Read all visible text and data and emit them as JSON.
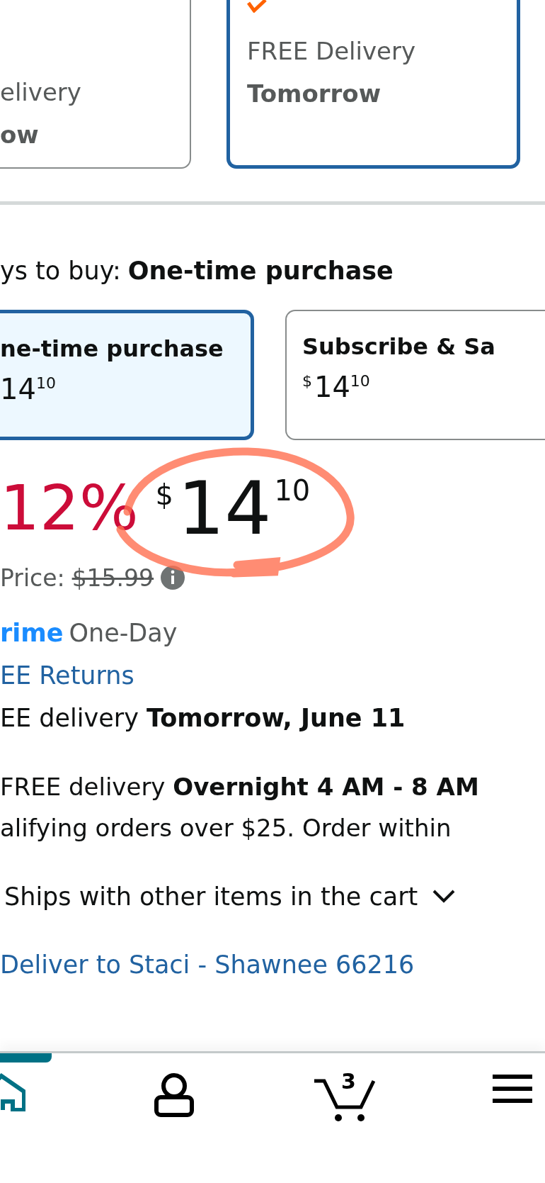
{
  "delivery_options": [
    {
      "lines": [
        "elivery",
        "ow"
      ],
      "selected": false,
      "prime": false
    },
    {
      "lines": [
        "FREE Delivery",
        "Tomorrow"
      ],
      "selected": true,
      "prime": true
    }
  ],
  "ways_to_buy": {
    "label": "ys to buy:",
    "value": "One-time purchase"
  },
  "purchase_options": [
    {
      "title": "ne-time purchase",
      "whole": "14",
      "fraction": "10",
      "selected": true
    },
    {
      "title": "Subscribe & Sa",
      "currency": "$",
      "whole": "14",
      "fraction": "10",
      "selected": false
    }
  ],
  "price": {
    "discount": "12%",
    "currency": "$",
    "whole": "14",
    "fraction": "10",
    "list_price_label": "Price:",
    "list_price": "$15.99"
  },
  "prime_badge": {
    "logo_text": "rime",
    "label": "One-Day"
  },
  "returns_link": "EE Returns",
  "delivery_line": "EE delivery **Tomorrow, June 11**",
  "fast_delivery": [
    "FREE delivery **Overnight 4 AM - 8 AM**",
    "alifying orders over $25. Order within"
  ],
  "ships_with": {
    "label": "Ships with other items in the cart",
    "expanded": false
  },
  "deliver_to": "Deliver to Staci - Shawnee 66216",
  "bottom_nav": [
    {
      "kind": "home",
      "selected": true
    },
    {
      "kind": "account",
      "selected": false
    },
    {
      "kind": "cart",
      "selected": false,
      "badge": "3"
    },
    {
      "kind": "menu",
      "selected": false
    }
  ]
}
